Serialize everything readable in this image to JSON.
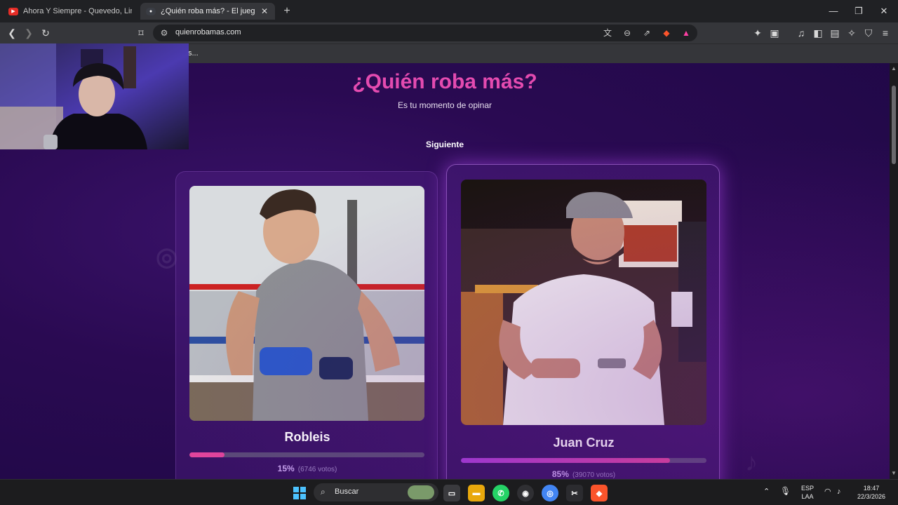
{
  "browser": {
    "tabs": [
      {
        "title": "Ahora Y Siempre - Quevedo, Linton",
        "active": false,
        "favicon": "youtube-icon"
      },
      {
        "title": "¿Quién roba más? - El juego que",
        "active": true,
        "favicon": "discord-icon"
      }
    ],
    "url": "quienrobamas.com",
    "bookmark_partial": "s..."
  },
  "page": {
    "title": "¿Quién roba más?",
    "subtitle": "Es tu momento de opinar",
    "next_label": "Siguiente"
  },
  "candidates": [
    {
      "name": "Robleis",
      "percent": 15,
      "percent_label": "15%",
      "votes_label": "(6746 votos)"
    },
    {
      "name": "Juan Cruz",
      "percent": 85,
      "percent_label": "85%",
      "votes_label": "(39070 votos)"
    }
  ],
  "taskbar": {
    "search_placeholder": "Buscar",
    "language": "ESP",
    "layout": "LAA",
    "time": "18:47",
    "date": "22/3/2026"
  },
  "colors": {
    "accent_pink": "#e44bb0",
    "background": "#2a0a52",
    "winner_glow": "#be50ff"
  }
}
